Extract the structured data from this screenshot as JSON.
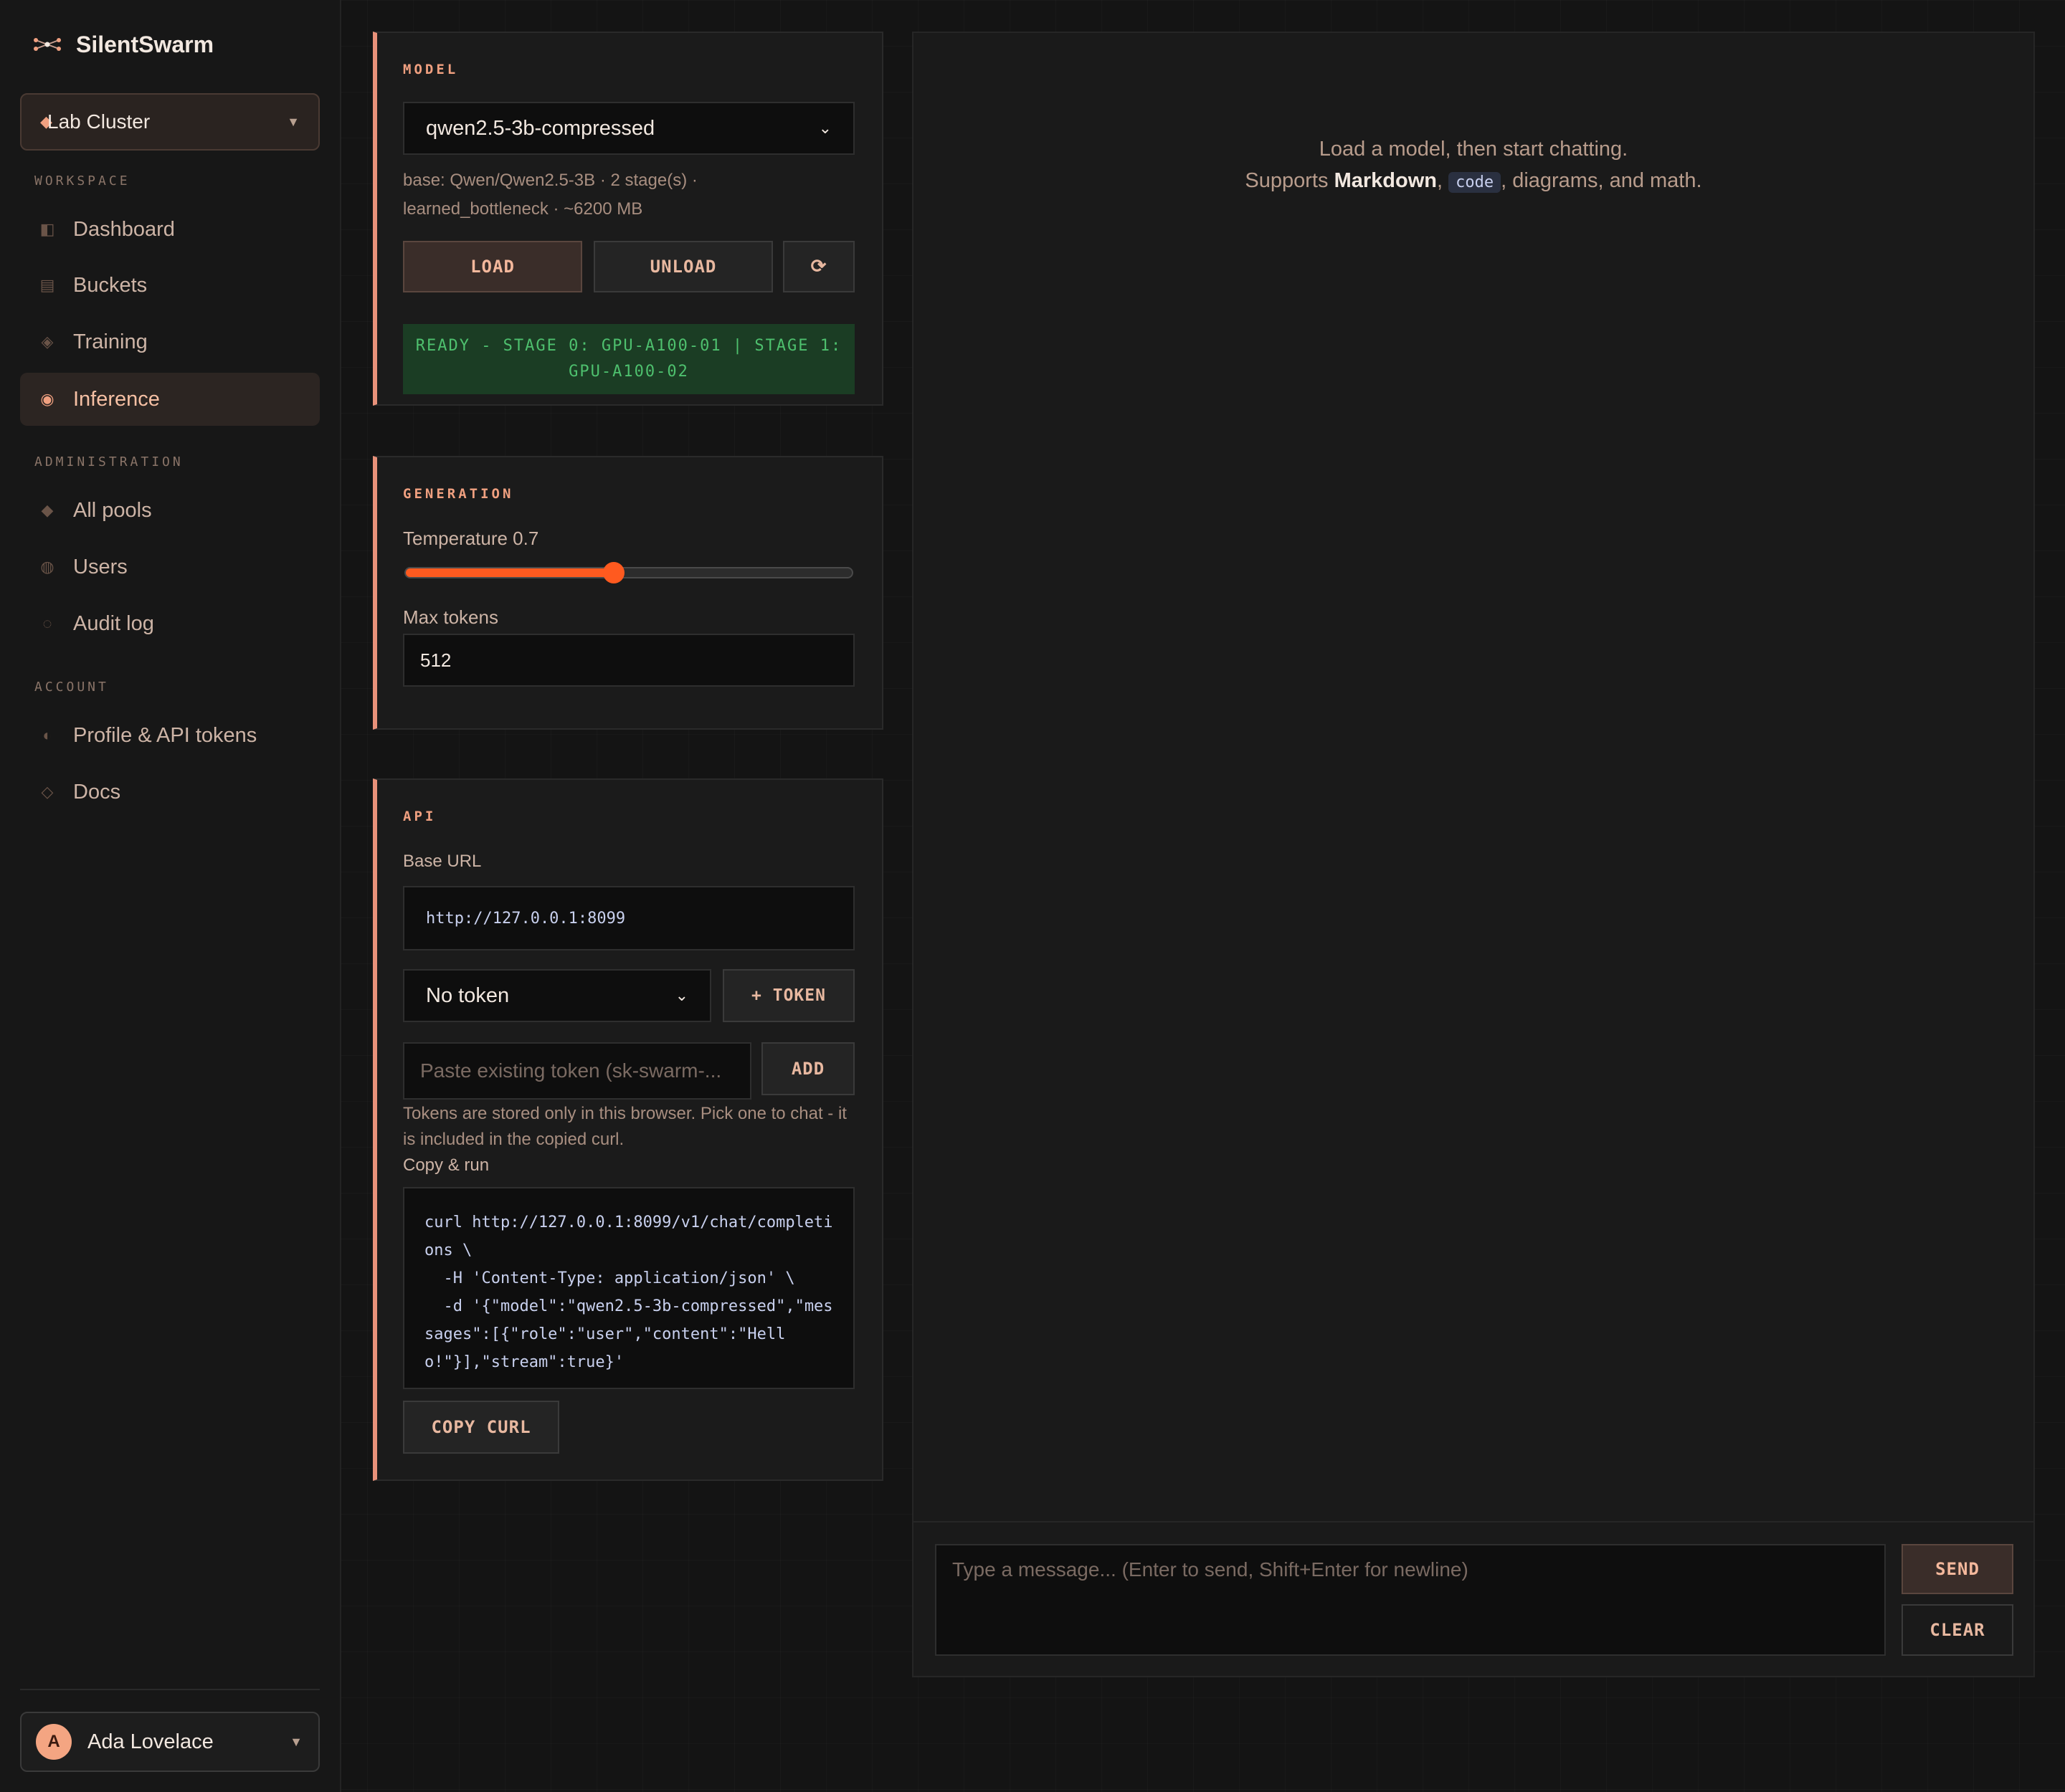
{
  "app": {
    "name": "SilentSwarm",
    "logo_icon": "swarm-icon"
  },
  "sidebar": {
    "cluster": {
      "label": "Lab Cluster"
    },
    "sections": {
      "workspace": "WORKSPACE",
      "administration": "ADMINISTRATION",
      "account": "ACCOUNT"
    },
    "workspace_items": [
      {
        "label": "Dashboard",
        "icon": "dashboard-icon"
      },
      {
        "label": "Buckets",
        "icon": "buckets-icon"
      },
      {
        "label": "Training",
        "icon": "training-icon"
      },
      {
        "label": "Inference",
        "icon": "inference-icon",
        "active": true
      }
    ],
    "admin_items": [
      {
        "label": "All pools",
        "icon": "pools-icon"
      },
      {
        "label": "Users",
        "icon": "users-icon"
      },
      {
        "label": "Audit log",
        "icon": "audit-icon"
      }
    ],
    "account_items": [
      {
        "label": "Profile & API tokens",
        "icon": "profile-icon"
      },
      {
        "label": "Docs",
        "icon": "docs-icon"
      }
    ],
    "user": {
      "initial": "A",
      "name": "Ada Lovelace"
    }
  },
  "model": {
    "title": "MODEL",
    "selected": "qwen2.5-3b-compressed",
    "info_line1": "base: Qwen/Qwen2.5-3B · 2 stage(s) ·",
    "info_line2": "learned_bottleneck · ~6200 MB",
    "load_label": "LOAD",
    "unload_label": "UNLOAD",
    "refresh_icon": "⟳",
    "status": "READY - STAGE 0: GPU-A100-01 | STAGE 1: GPU-A100-02"
  },
  "generation": {
    "title": "GENERATION",
    "temperature_label": "Temperature 0.7",
    "temperature_value": 0.7,
    "temperature_max": 1.5,
    "max_tokens_label": "Max tokens",
    "max_tokens_value": "512"
  },
  "api": {
    "title": "API",
    "base_url_label": "Base URL",
    "base_url": "http://127.0.0.1:8099",
    "token_select": "No token",
    "new_token_label": "+ TOKEN",
    "paste_placeholder": "Paste existing token (sk-swarm-...",
    "add_label": "ADD",
    "note": "Tokens are stored only in this browser. Pick one to chat - it is included in the copied curl.",
    "copy_run_label": "Copy & run",
    "curl": "curl http://127.0.0.1:8099/v1/chat/completions \\\n  -H 'Content-Type: application/json' \\\n  -d '{\"model\":\"qwen2.5-3b-compressed\",\"messages\":[{\"role\":\"user\",\"content\":\"Hello!\"}],\"stream\":true}'",
    "copy_curl_label": "COPY CURL"
  },
  "chat": {
    "empty_line1": "Load a model, then start chatting.",
    "empty_supports": "Supports ",
    "empty_markdown": "Markdown",
    "empty_comma": ", ",
    "empty_code": "code",
    "empty_rest": ", diagrams, and math.",
    "input_placeholder": "Type a message... (Enter to send, Shift+Enter for newline)",
    "send_label": "SEND",
    "clear_label": "CLEAR"
  },
  "colors": {
    "accent": "#e8917a",
    "slider": "#ff5a1f",
    "status_green": "#4ec06e"
  }
}
